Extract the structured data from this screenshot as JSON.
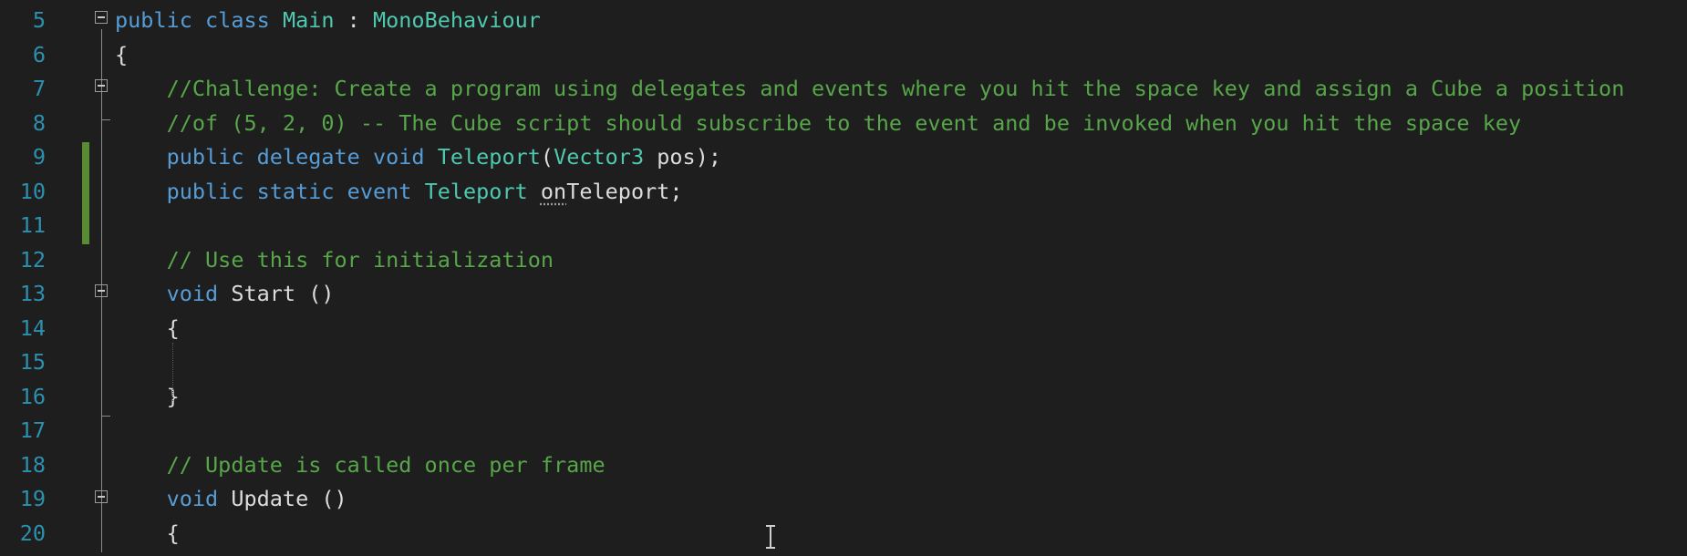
{
  "editor": {
    "colors": {
      "background": "#1e1e1e",
      "line_number": "#2b91af",
      "keyword": "#569cd6",
      "type": "#4ec9b0",
      "comment": "#57a64a",
      "text": "#dcdcdc",
      "change_bar": "#578c34"
    },
    "lines": [
      {
        "number": "5",
        "code": [
          {
            "kw": "public class "
          },
          {
            "ty": "Main"
          },
          {
            "tx": " : "
          },
          {
            "ty": "MonoBehaviour"
          }
        ]
      },
      {
        "number": "6",
        "code": [
          {
            "tx": "{"
          }
        ]
      },
      {
        "number": "7",
        "code": [
          {
            "cm": "    //Challenge: Create a program using delegates and events where you hit the space key and assign a Cube a position"
          }
        ]
      },
      {
        "number": "8",
        "code": [
          {
            "cm": "    //of (5, 2, 0) -- The Cube script should subscribe to the event and be invoked when you hit the space key"
          }
        ]
      },
      {
        "number": "9",
        "code": [
          {
            "kw": "    public delegate void "
          },
          {
            "ty": "Teleport"
          },
          {
            "tx": "("
          },
          {
            "ty": "Vector3"
          },
          {
            "tx": " pos);"
          }
        ]
      },
      {
        "number": "10",
        "code": [
          {
            "kw": "    public static event "
          },
          {
            "ty": "Teleport"
          },
          {
            "tx": " "
          },
          {
            "sq": "on"
          },
          {
            "tx": "Teleport;"
          }
        ]
      },
      {
        "number": "11",
        "code": []
      },
      {
        "number": "12",
        "code": [
          {
            "cm": "    // Use this for initialization"
          }
        ]
      },
      {
        "number": "13",
        "code": [
          {
            "kw": "    void "
          },
          {
            "tx": "Start ()"
          }
        ]
      },
      {
        "number": "14",
        "code": [
          {
            "tx": "    {"
          }
        ]
      },
      {
        "number": "15",
        "code": []
      },
      {
        "number": "16",
        "code": [
          {
            "tx": "    }"
          }
        ]
      },
      {
        "number": "17",
        "code": []
      },
      {
        "number": "18",
        "code": [
          {
            "cm": "    // Update is called once per frame"
          }
        ]
      },
      {
        "number": "19",
        "code": [
          {
            "kw": "    void "
          },
          {
            "tx": "Update ()"
          }
        ]
      },
      {
        "number": "20",
        "code": [
          {
            "tx": "    {"
          }
        ]
      }
    ]
  }
}
